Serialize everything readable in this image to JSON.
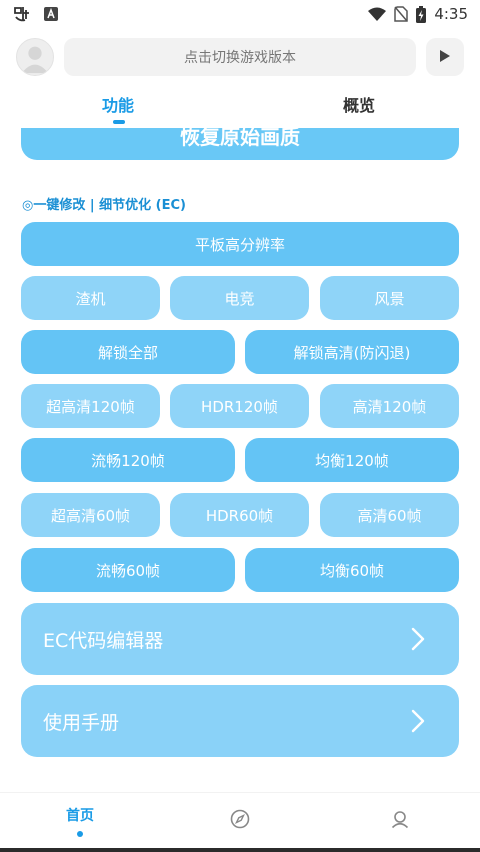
{
  "status_bar": {
    "time": "4:35",
    "icons": [
      "app-logo-icon",
      "a-notification-icon",
      "wifi-icon",
      "no-sim-icon",
      "battery-charging-icon"
    ]
  },
  "header": {
    "version_placeholder": "点击切换游戏版本",
    "avatar_icon": "user-avatar-icon",
    "play_icon": "play-icon"
  },
  "tabs": [
    {
      "label": "功能",
      "active": true
    },
    {
      "label": "概览",
      "active": false
    }
  ],
  "main": {
    "restore_label": "恢复原始画质",
    "section_label": "◎一键修改 | 细节优化 (EC)",
    "tablet_label": "平板高分辨率",
    "row_presets": [
      "渣机",
      "电竞",
      "风景"
    ],
    "row_unlock": [
      "解锁全部",
      "解锁高清(防闪退)"
    ],
    "row_120_a": [
      "超高清120帧",
      "HDR120帧",
      "高清120帧"
    ],
    "row_120_b": [
      "流畅120帧",
      "均衡120帧"
    ],
    "row_60_a": [
      "超高清60帧",
      "HDR60帧",
      "高清60帧"
    ],
    "row_60_b": [
      "流畅60帧",
      "均衡60帧"
    ],
    "ec_editor_label": "EC代码编辑器",
    "manual_label": "使用手册"
  },
  "bottom_nav": {
    "home_label": "首页",
    "discover_icon": "compass-icon",
    "profile_icon": "profile-icon"
  },
  "colors": {
    "accent": "#1a9be6",
    "button_dark": "#64c4f5",
    "button_light": "#8fd4f8",
    "panel": "#8ad2f8"
  }
}
